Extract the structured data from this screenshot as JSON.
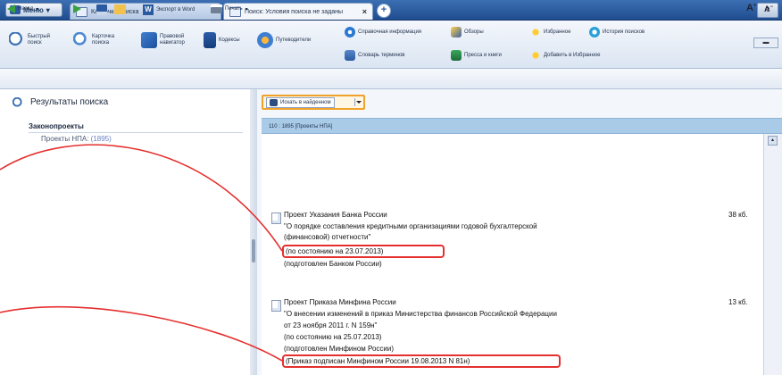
{
  "tabstrip": {
    "menu_label": "Меню",
    "tabs": [
      {
        "label": "Карточка поиска",
        "active": false
      },
      {
        "label": "Поиск: Условия поиска не заданы",
        "active": true
      }
    ],
    "new_tab_label": "+",
    "help_label": "?"
  },
  "ribbon": {
    "quick_search": "Быстрый поиск",
    "search_card": "Карточка поиска",
    "legal_navigator": "Правовой навигатор",
    "codes": "Кодексы",
    "guides": "Путеводители",
    "reference_info": "Справочная информация",
    "reviews": "Обзоры",
    "favorites": "Избранное",
    "search_history": "История поисков",
    "terms_dictionary": "Словарь терминов",
    "press_books": "Пресса и книги",
    "add_to_favorites": "Добавить в Избранное",
    "scroll_label": "▬"
  },
  "quick_toolbar": {
    "back_label": "Назад",
    "export_word": "Экспорт в Word",
    "print": "Печать",
    "font_large": "A",
    "font_small": "A"
  },
  "left_panel": {
    "title": "Результаты поиска",
    "section_title": "Законопроекты",
    "item_label": "Проекты НПА:",
    "item_count": "(1895)"
  },
  "right_panel": {
    "search_in_found": "Искать в найденном",
    "range_text": "110 : 1895 [Проекты НПА]",
    "results": [
      {
        "lines": [
          "Проект Указания Банка России",
          "\"О порядке составления кредитными организациями годовой бухгалтерской",
          "(финансовой) отчетности\"",
          "(по состоянию на 23.07.2013)",
          "(подготовлен Банком России)"
        ],
        "size": "38 кб."
      },
      {
        "lines": [
          "Проект Приказа Минфина России",
          "\"О внесении изменений в приказ Министерства финансов Российской Федерации",
          "от 23 ноября 2011 г. N 159н\"",
          "(по состоянию на 25.07.2013)",
          "(подготовлен Минфином России)",
          "(Приказ подписан Минфином России 19.08.2013 N 81н)"
        ],
        "size": "13 кб."
      }
    ]
  },
  "colors": {
    "tab_strip": "#2a5a9c",
    "highlight_orange": "#f0a22b",
    "highlight_red": "#e4302f",
    "range_bar": "#a9cbe8"
  }
}
